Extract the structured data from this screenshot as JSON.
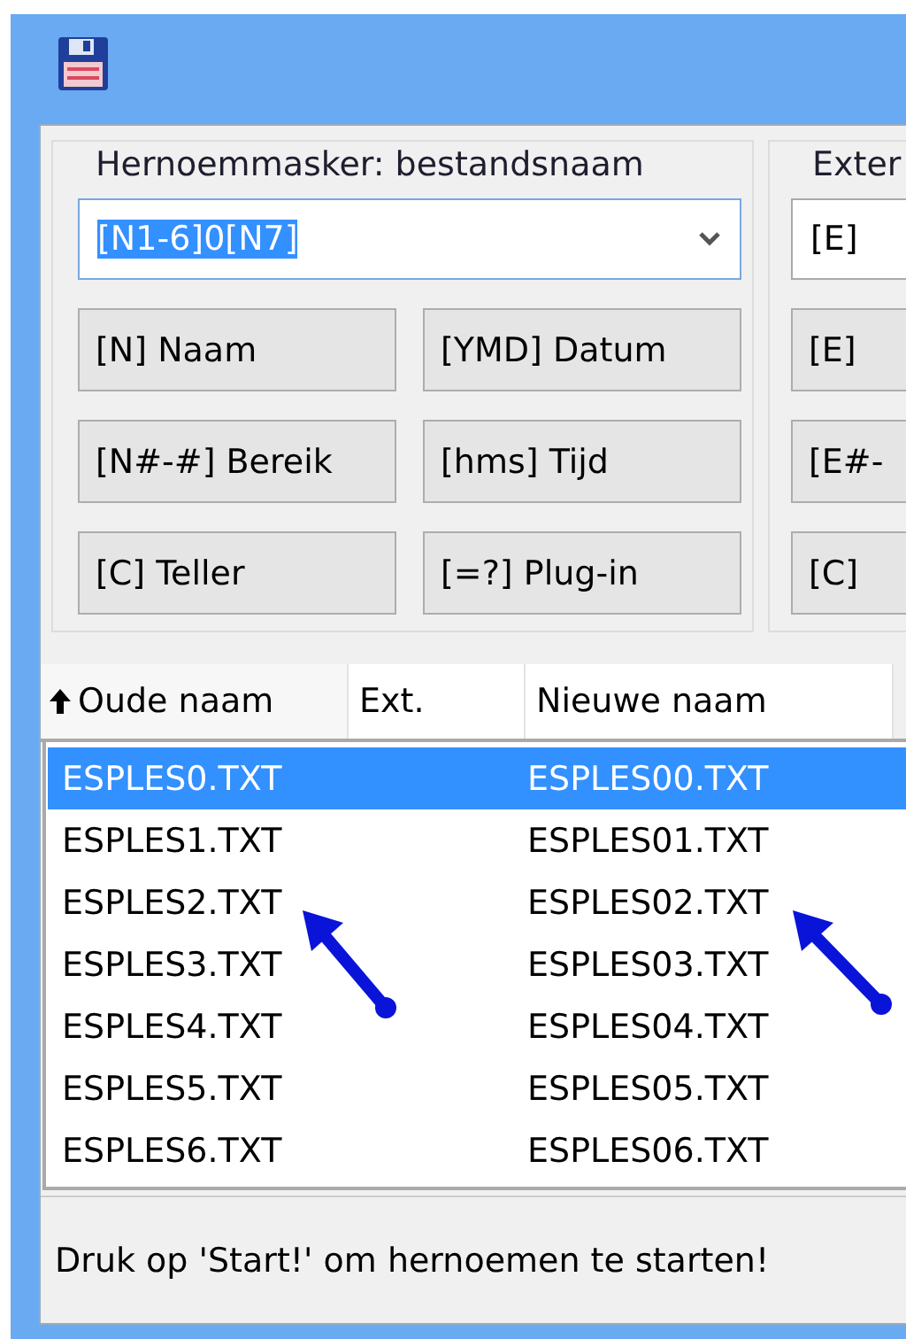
{
  "name_group": {
    "label": "Hernoemmasker: bestandsnaam",
    "mask": {
      "value": "[N1-6]0[N7]",
      "text_selected": true
    },
    "buttons": [
      "[N]  Naam",
      "[YMD]  Datum",
      "[N#-#] Bereik",
      "[hms]  Tijd",
      "[C]  Teller",
      "[=?]  Plug-in"
    ]
  },
  "ext_group": {
    "label": "Exter",
    "mask": {
      "value": "[E]"
    },
    "buttons": [
      "[E]",
      "[E#-",
      "[C]"
    ]
  },
  "table": {
    "columns": [
      {
        "label": "Oude naam",
        "sorted": true
      },
      {
        "label": "Ext.",
        "sorted": false
      },
      {
        "label": "Nieuwe naam",
        "sorted": false
      }
    ],
    "rows": [
      {
        "old": "ESPLES0.TXT",
        "new": "ESPLES00.TXT",
        "selected": true
      },
      {
        "old": "ESPLES1.TXT",
        "new": "ESPLES01.TXT",
        "selected": false
      },
      {
        "old": "ESPLES2.TXT",
        "new": "ESPLES02.TXT",
        "selected": false
      },
      {
        "old": "ESPLES3.TXT",
        "new": "ESPLES03.TXT",
        "selected": false
      },
      {
        "old": "ESPLES4.TXT",
        "new": "ESPLES04.TXT",
        "selected": false
      },
      {
        "old": "ESPLES5.TXT",
        "new": "ESPLES05.TXT",
        "selected": false
      },
      {
        "old": "ESPLES6.TXT",
        "new": "ESPLES06.TXT",
        "selected": false
      }
    ]
  },
  "status_bar": "Druk op 'Start!' om hernoemen te starten!"
}
